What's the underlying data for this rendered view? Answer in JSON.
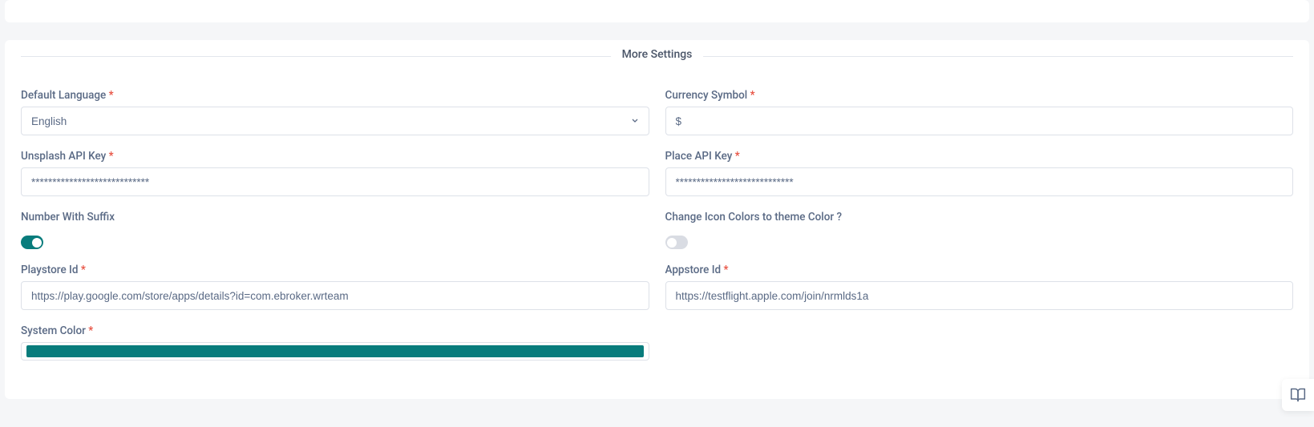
{
  "section_title": "More Settings",
  "fields": {
    "default_language": {
      "label": "Default Language",
      "value": "English"
    },
    "currency_symbol": {
      "label": "Currency Symbol",
      "value": "$"
    },
    "unsplash_api_key": {
      "label": "Unsplash API Key",
      "value": "****************************"
    },
    "place_api_key": {
      "label": "Place API Key",
      "value": "****************************"
    },
    "number_with_suffix": {
      "label": "Number With Suffix",
      "value": true
    },
    "change_icon_colors": {
      "label": "Change Icon Colors to theme Color ?",
      "value": false
    },
    "playstore_id": {
      "label": "Playstore Id",
      "value": "https://play.google.com/store/apps/details?id=com.ebroker.wrteam"
    },
    "appstore_id": {
      "label": "Appstore Id",
      "value": "https://testflight.apple.com/join/nrmlds1a"
    },
    "system_color": {
      "label": "System Color",
      "value": "#087c7c"
    }
  },
  "required_marker": "*"
}
